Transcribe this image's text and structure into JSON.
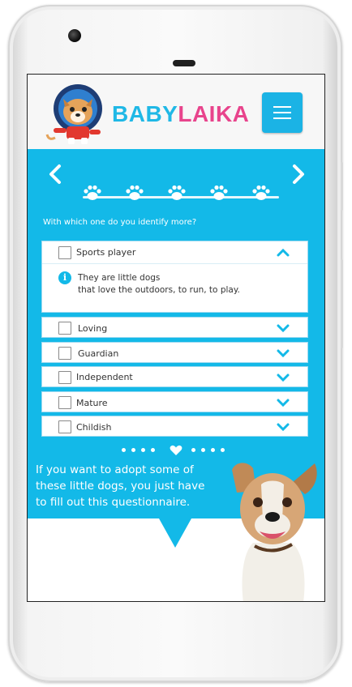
{
  "brand": {
    "name_part1": "BABY",
    "name_part2": "LAIKA",
    "color1": "#1fb8e6",
    "color2": "#e8448c"
  },
  "header": {
    "menu_icon": "hamburger-icon"
  },
  "nav": {
    "prev_icon": "chevron-left-icon",
    "next_icon": "chevron-right-icon",
    "steps": 5
  },
  "question": "With which one do you identify more?",
  "options": [
    {
      "label": "Sports player",
      "expanded": true,
      "info": [
        "They are little dogs",
        "that love the outdoors, to run, to play."
      ]
    },
    {
      "label": "Loving"
    },
    {
      "label": "Guardian"
    },
    {
      "label": "Independent"
    },
    {
      "label": "Mature"
    },
    {
      "label": "Childish"
    }
  ],
  "pager": {
    "total": 9,
    "active": 5
  },
  "adopt_text": "If you want to adopt some of these little dogs, you just have to fill out this questionnaire.",
  "colors": {
    "accent": "#13b9e8"
  }
}
